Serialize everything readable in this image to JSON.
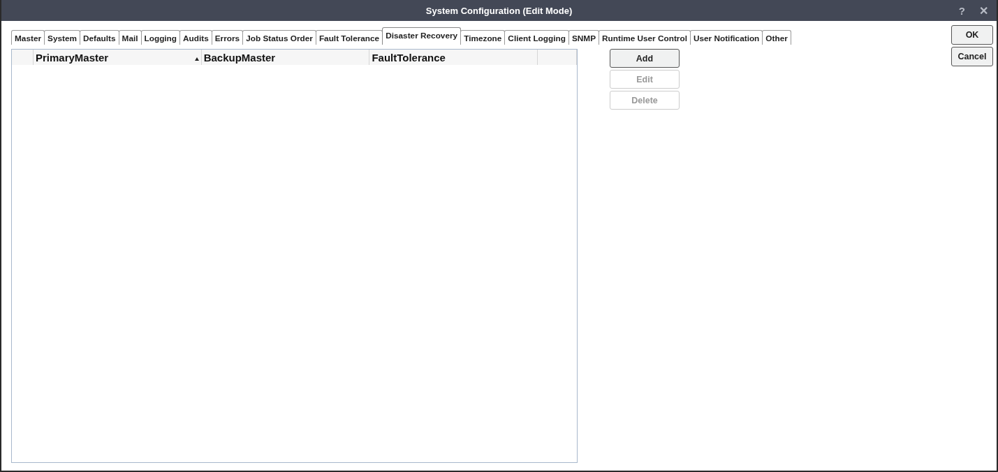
{
  "window": {
    "title": "System Configuration (Edit Mode)",
    "help": "?",
    "close": "✕"
  },
  "tabs": [
    {
      "label": "Master",
      "selected": false
    },
    {
      "label": "System",
      "selected": false
    },
    {
      "label": "Defaults",
      "selected": false
    },
    {
      "label": "Mail",
      "selected": false
    },
    {
      "label": "Logging",
      "selected": false
    },
    {
      "label": "Audits",
      "selected": false
    },
    {
      "label": "Errors",
      "selected": false
    },
    {
      "label": "Job Status Order",
      "selected": false
    },
    {
      "label": "Fault Tolerance",
      "selected": false
    },
    {
      "label": "Disaster Recovery",
      "selected": true
    },
    {
      "label": "Timezone",
      "selected": false
    },
    {
      "label": "Client Logging",
      "selected": false
    },
    {
      "label": "SNMP",
      "selected": false
    },
    {
      "label": "Runtime User Control",
      "selected": false
    },
    {
      "label": "User Notification",
      "selected": false
    },
    {
      "label": "Other",
      "selected": false
    }
  ],
  "table": {
    "columns": [
      {
        "label": "PrimaryMaster",
        "sorted_ascending": true
      },
      {
        "label": "BackupMaster",
        "sorted_ascending": false
      },
      {
        "label": "FaultTolerance",
        "sorted_ascending": false
      }
    ]
  },
  "actions": [
    {
      "label": "Add",
      "disabled": false
    },
    {
      "label": "Edit",
      "disabled": true
    },
    {
      "label": "Delete",
      "disabled": true
    }
  ],
  "dialog_buttons": [
    "OK",
    "Cancel"
  ]
}
